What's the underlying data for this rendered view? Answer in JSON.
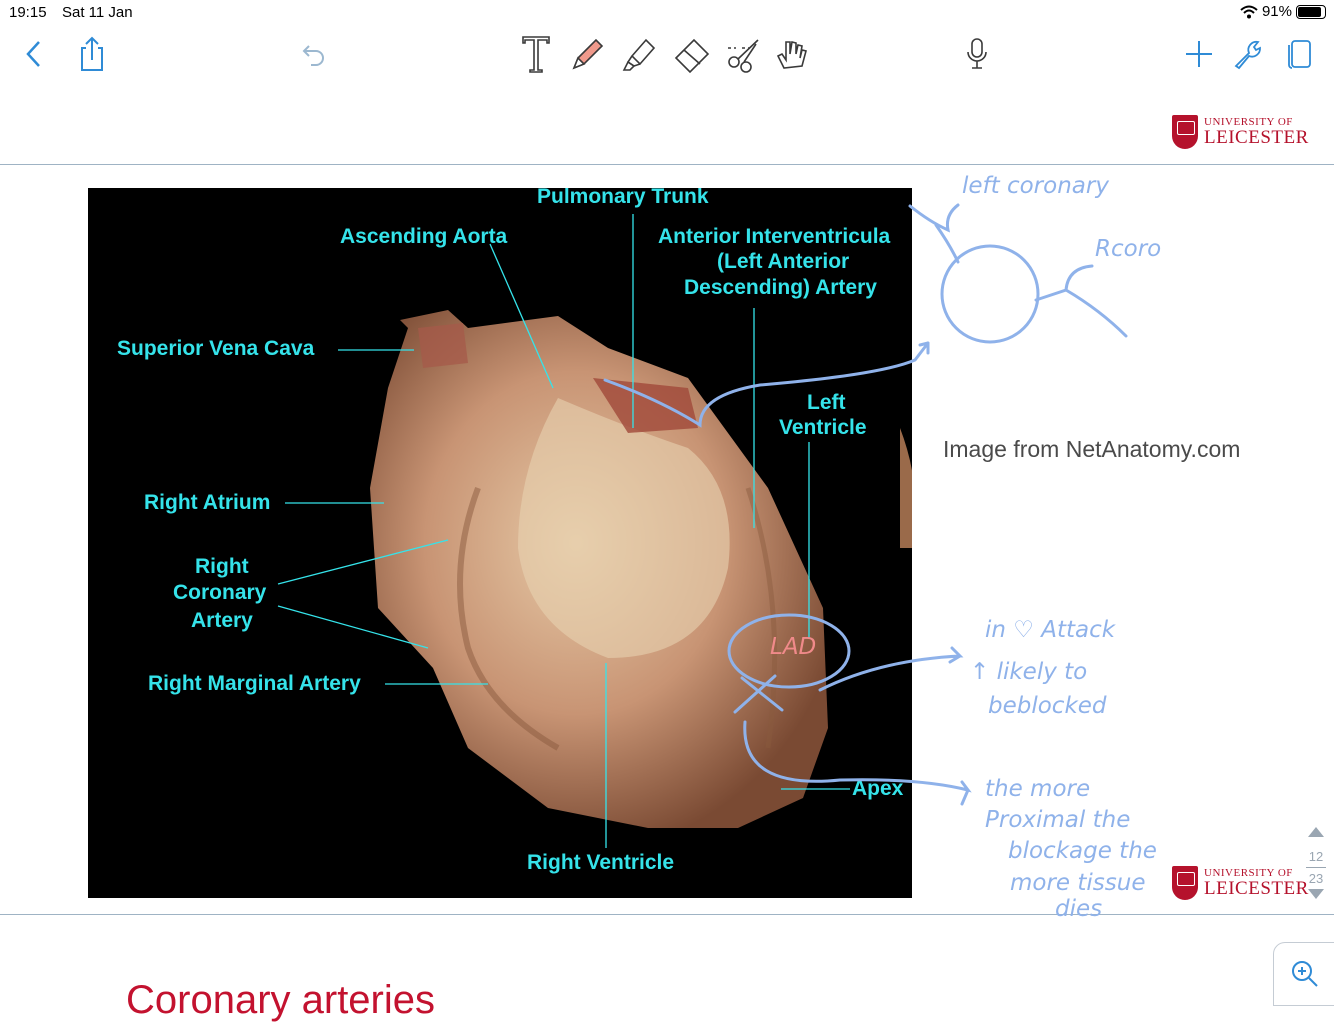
{
  "status_bar": {
    "time": "19:15",
    "date": "Sat 11 Jan",
    "battery": "91%",
    "battery_level": 0.91
  },
  "toolbar": {
    "left": [
      {
        "name": "back-button",
        "icon": "chevron-left-icon"
      },
      {
        "name": "share-button",
        "icon": "share-icon"
      },
      {
        "name": "undo-button",
        "icon": "undo-icon"
      }
    ],
    "center": [
      {
        "name": "text-tool",
        "icon": "text-tool-icon"
      },
      {
        "name": "pen-tool",
        "icon": "pen-icon"
      },
      {
        "name": "highlighter-tool",
        "icon": "highlighter-icon"
      },
      {
        "name": "eraser-tool",
        "icon": "eraser-icon"
      },
      {
        "name": "lasso-tool",
        "icon": "scissors-lasso-icon"
      },
      {
        "name": "hand-tool",
        "icon": "hand-pointer-icon"
      }
    ],
    "mic": {
      "name": "microphone-button",
      "icon": "microphone-icon"
    },
    "right": [
      {
        "name": "add-button",
        "icon": "plus-icon"
      },
      {
        "name": "settings-button",
        "icon": "wrench-icon"
      },
      {
        "name": "pages-button",
        "icon": "pages-icon"
      }
    ],
    "accent": "#2f8bd6"
  },
  "slide": {
    "logo_top": "UNIVERSITY OF",
    "logo_bottom": "LEICESTER",
    "brand_color": "#b5122c",
    "image_credit": "Image from NetAnatomy.com",
    "labels": {
      "pulmonary_trunk": "Pulmonary Trunk",
      "ascending_aorta": "Ascending Aorta",
      "anterior_interventricular_1": "Anterior Interventricula",
      "anterior_interventricular_2": "(Left Anterior",
      "anterior_interventricular_3": "Descending) Artery",
      "superior_vena_cava": "Superior Vena Cava",
      "left_ventricle_1": "Left",
      "left_ventricle_2": "Ventricle",
      "right_atrium": "Right Atrium",
      "rca_1": "Right",
      "rca_2": "Coronary",
      "rca_3": "Artery",
      "right_marginal": "Right Marginal Artery",
      "apex": "Apex",
      "right_ventricle": "Right Ventricle"
    },
    "label_color": "#35e3ea",
    "next_title": "Coronary arteries"
  },
  "annotations": {
    "ink_color": "#8fb2ea",
    "left_coronary": "left coronary",
    "rcoro": "Rcoro",
    "lad": "LAD",
    "lad_color": "#f08a8a",
    "attack_1": "in ♡ Attack",
    "attack_2": "↑ likely to",
    "attack_3": "beblocked",
    "proximal_1": "the more",
    "proximal_2": "Proximal the",
    "proximal_3": "blockage the",
    "proximal_4": "more tissue",
    "proximal_5": "dies"
  },
  "pager": {
    "current": "12",
    "total": "23"
  },
  "zoom": {
    "icon": "zoom-in-icon"
  }
}
